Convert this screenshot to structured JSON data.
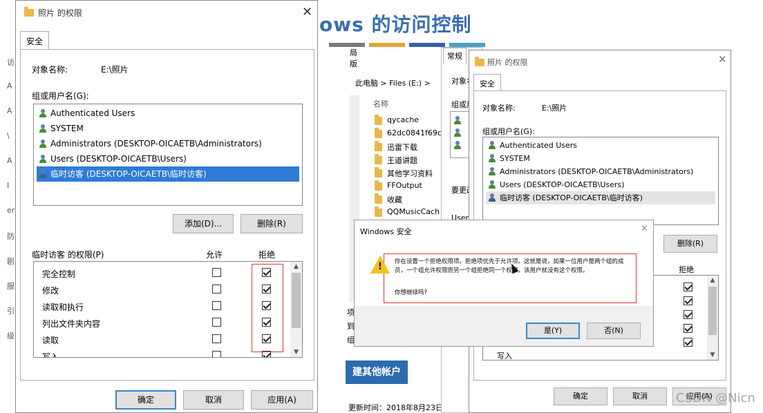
{
  "slide": {
    "title": "ows 的访问控制",
    "deco_colors": [
      "#7a7a7a",
      "#e8a33a",
      "#3a5fb0",
      "#4aa0c8"
    ]
  },
  "edge_glyphs": [
    "访",
    "A",
    "A",
    "\\",
    "A",
    "I",
    "er",
    "防",
    "剧",
    "服",
    "引",
    "级"
  ],
  "left_dialog": {
    "title": "照片 的权限",
    "tab": "安全",
    "object_label": "对象名称:",
    "object_value": "E:\\照片",
    "groups_label": "组或用户名(G):",
    "users": [
      {
        "name": "Authenticated Users",
        "icon": "group-users-icon"
      },
      {
        "name": "SYSTEM",
        "icon": "group-users-icon"
      },
      {
        "name": "Administrators (DESKTOP-OICAETB\\Administrators)",
        "icon": "group-users-icon"
      },
      {
        "name": "Users (DESKTOP-OICAETB\\Users)",
        "icon": "group-users-icon"
      },
      {
        "name": "临时访客 (DESKTOP-OICAETB\\临时访客)",
        "icon": "single-user-icon",
        "selected": true
      }
    ],
    "add_button": "添加(D)...",
    "remove_button": "删除(R)",
    "perm_label": "临时访客 的权限(P)",
    "allow_header": "允许",
    "deny_header": "拒绝",
    "permissions": [
      {
        "name": "完全控制",
        "allow": false,
        "deny": true
      },
      {
        "name": "修改",
        "allow": false,
        "deny": true
      },
      {
        "name": "读取和执行",
        "allow": false,
        "deny": true
      },
      {
        "name": "列出文件夹内容",
        "allow": false,
        "deny": true
      },
      {
        "name": "读取",
        "allow": false,
        "deny": true
      },
      {
        "name": "写入",
        "allow": false,
        "deny": true
      }
    ],
    "ok_button": "确定",
    "cancel_button": "取消",
    "apply_button": "应用(A)"
  },
  "explorer": {
    "ribbon_lines": [
      "局",
      "版"
    ],
    "breadcrumb": [
      "此电脑",
      ">",
      "Files (E:)",
      ">"
    ],
    "column_header": "名称",
    "folders": [
      "qycache",
      "62dc0841f69c",
      "迅雷下载",
      "王道讲题",
      "其他学习资料",
      "FFOutput",
      "收藏",
      "QQMusicCach"
    ],
    "bottom_text": [
      "项",
      "到",
      "组"
    ],
    "create_account": "建其他帐户",
    "updated": "更新时间：2018年8月23日"
  },
  "props_dialog": {
    "tab": "常规",
    "lines": [
      "对象名",
      "组或用",
      "要更改",
      "User"
    ]
  },
  "right_dialog": {
    "title": "照片 的权限",
    "tab": "安全",
    "object_label": "对象名称:",
    "object_value": "E:\\照片",
    "groups_label": "组或用户名(G):",
    "users": [
      {
        "name": "Authenticated Users",
        "icon": "group-users-icon"
      },
      {
        "name": "SYSTEM",
        "icon": "group-users-icon"
      },
      {
        "name": "Administrators (DESKTOP-OICAETB\\Administrators)",
        "icon": "group-users-icon"
      },
      {
        "name": "Users (DESKTOP-OICAETB\\Users)",
        "icon": "group-users-icon"
      },
      {
        "name": "临时访客 (DESKTOP-OICAETB\\临时访客)",
        "icon": "single-user-icon",
        "selected": true
      }
    ],
    "remove_button": "删除(R)",
    "deny_header": "拒绝",
    "first_perm_partial": "写入",
    "ok_button": "确定",
    "cancel_button": "取消",
    "apply_button": "应用(A)"
  },
  "confirm_dialog": {
    "title": "Windows 安全",
    "message": "你在设置一个拒绝权限项。拒绝项优先于允许项。这就是说，如果一位用户是两个组的成员，一个组允许权限而另一个组拒绝同一个权限，该用户就没有这个权限。",
    "question": "你想继续吗?",
    "yes_button": "是(Y)",
    "no_button": "否(N)"
  },
  "watermark": "CSDN @Nicn"
}
